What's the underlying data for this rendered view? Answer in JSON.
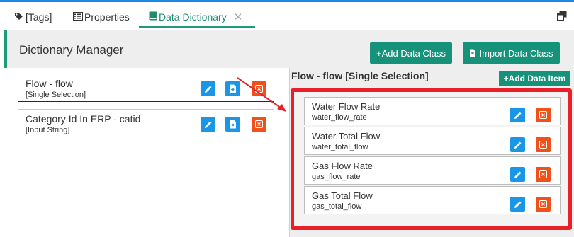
{
  "tabs": [
    {
      "label": "[Tags]",
      "icon": "tags-icon"
    },
    {
      "label": "Properties",
      "icon": "list-icon"
    },
    {
      "label": "Data Dictionary",
      "icon": "book-icon",
      "active": true
    }
  ],
  "header": {
    "title": "Dictionary Manager",
    "add_class_label": "+Add Data Class",
    "import_class_label": "Import Data Class"
  },
  "data_classes": [
    {
      "title": "Flow - flow",
      "subtitle": "[Single Selection]",
      "selected": true
    },
    {
      "title": "Category Id In ERP - catid",
      "subtitle": "[Input String]",
      "selected": false
    }
  ],
  "detail": {
    "title": "Flow - flow [Single Selection]",
    "add_item_label": "+Add Data Item",
    "items": [
      {
        "title": "Water Flow Rate",
        "key": "water_flow_rate"
      },
      {
        "title": "Water Total Flow",
        "key": "water_total_flow"
      },
      {
        "title": "Gas Flow Rate",
        "key": "gas_flow_rate"
      },
      {
        "title": "Gas Total Flow",
        "key": "gas_total_flow"
      }
    ]
  },
  "colors": {
    "accent": "#1f9b7a",
    "button_green": "#16927a",
    "edit_blue": "#1996e6",
    "delete_red": "#f0511a",
    "highlight_red": "#e8202a"
  }
}
